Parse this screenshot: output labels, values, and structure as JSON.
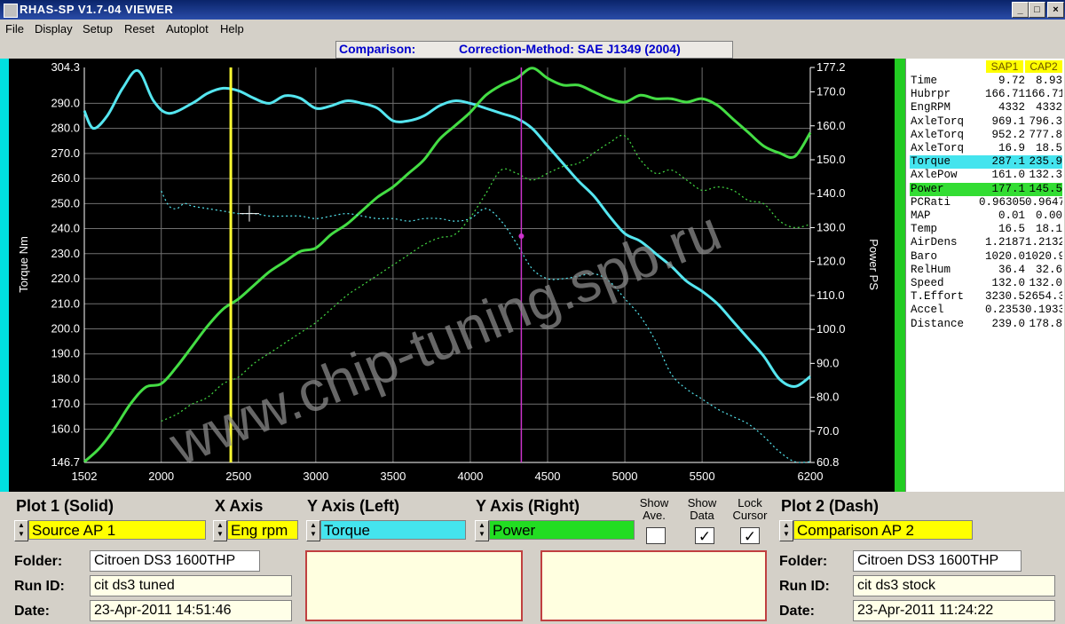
{
  "window": {
    "title": "RHAS-SP V1.7-04  VIEWER",
    "controls": [
      "_",
      "□",
      "×"
    ]
  },
  "menu": [
    "File",
    "Display",
    "Setup",
    "Reset",
    "Autoplot",
    "Help"
  ],
  "header": {
    "comparison": "Comparison:",
    "method": "Correction-Method: SAE J1349 (2004)"
  },
  "watermark": "www.chip-tuning.spb.ru",
  "chart_data": {
    "type": "line",
    "x_ticks": [
      "1502",
      "2000",
      "2500",
      "3000",
      "3500",
      "4000",
      "4500",
      "5000",
      "5500",
      "6200"
    ],
    "xlim": [
      1502,
      6200
    ],
    "ylabel_left": "Torque Nm",
    "ylabel_right": "Power PS",
    "ylim_left": [
      146.7,
      304.3
    ],
    "ylim_right": [
      60.8,
      177.2
    ],
    "y_ticks_left": [
      "304.3",
      "290.0",
      "280.0",
      "270.0",
      "260.0",
      "250.0",
      "240.0",
      "230.0",
      "220.0",
      "210.0",
      "200.0",
      "190.0",
      "180.0",
      "170.0",
      "160.0",
      "146.7"
    ],
    "y_ticks_right": [
      "177.2",
      "170.0",
      "160.0",
      "150.0",
      "140.0",
      "130.0",
      "120.0",
      "110.0",
      "100.0",
      "90.0",
      "80.0",
      "70.0",
      "60.8"
    ],
    "grid": true,
    "cursor_rpm": 2450,
    "cursor2_rpm": 4330,
    "colors": {
      "torque": "#55e6f0",
      "power": "#44dd44",
      "cursor1": "#ffff33",
      "cursor2": "#cc33cc",
      "grid": "#707070"
    },
    "series": [
      {
        "name": "Torque",
        "axis": "left",
        "style": "solid",
        "x": [
          1502,
          1560,
          1650,
          1750,
          1850,
          1950,
          2050,
          2200,
          2300,
          2400,
          2500,
          2600,
          2700,
          2800,
          2900,
          3000,
          3100,
          3200,
          3300,
          3400,
          3500,
          3600,
          3700,
          3800,
          3900,
          4000,
          4100,
          4200,
          4300,
          4400,
          4500,
          4600,
          4700,
          4800,
          4900,
          5000,
          5100,
          5200,
          5300,
          5400,
          5500,
          5600,
          5700,
          5800,
          5900,
          6000,
          6100,
          6200
        ],
        "values": [
          287,
          280,
          285,
          296,
          303,
          291,
          286,
          290,
          294,
          296,
          295,
          292,
          290,
          293,
          292,
          288,
          289,
          291,
          290,
          288,
          283,
          283,
          285,
          289,
          291,
          290,
          288,
          286,
          284,
          280,
          273,
          266,
          259,
          253,
          245,
          238,
          235,
          230,
          225,
          219,
          215,
          210,
          203,
          196,
          189,
          180,
          177,
          181
        ]
      },
      {
        "name": "Power",
        "axis": "right",
        "style": "solid",
        "x": [
          1502,
          1600,
          1700,
          1800,
          1900,
          2000,
          2100,
          2200,
          2300,
          2400,
          2500,
          2600,
          2700,
          2800,
          2900,
          3000,
          3100,
          3200,
          3300,
          3400,
          3500,
          3600,
          3700,
          3800,
          3900,
          4000,
          4100,
          4200,
          4300,
          4400,
          4500,
          4600,
          4700,
          4800,
          4900,
          5000,
          5100,
          5200,
          5300,
          5400,
          5500,
          5600,
          5700,
          5800,
          5900,
          6000,
          6100,
          6200
        ],
        "values": [
          61,
          65,
          71,
          78,
          83,
          84,
          89,
          95,
          101,
          106,
          109,
          113,
          117,
          120,
          123,
          124,
          128,
          131,
          135,
          139,
          142,
          146,
          150,
          156,
          160,
          164,
          169,
          172,
          174,
          177,
          174,
          172,
          172,
          170,
          168,
          167,
          169,
          168,
          168,
          167,
          168,
          166,
          162,
          158,
          154,
          152,
          151,
          158
        ]
      },
      {
        "name": "Torque",
        "axis": "left",
        "style": "dashed",
        "x": [
          2000,
          2050,
          2100,
          2150,
          2200,
          2300,
          2400,
          2500,
          2600,
          2700,
          2800,
          2900,
          3000,
          3100,
          3200,
          3300,
          3400,
          3500,
          3600,
          3700,
          3800,
          3900,
          4000,
          4100,
          4200,
          4300,
          4400,
          4500,
          4600,
          4700,
          4800,
          4900,
          5000,
          5100,
          5200,
          5300,
          5400,
          5500,
          5600,
          5700,
          5800,
          5900,
          6000,
          6100,
          6200
        ],
        "values": [
          255,
          249,
          248,
          250,
          249,
          248,
          247,
          246,
          246,
          245,
          245,
          245,
          244,
          245,
          246,
          245,
          244,
          244,
          243,
          244,
          244,
          243,
          244,
          248,
          243,
          234,
          224,
          220,
          220,
          221,
          222,
          219,
          212,
          205,
          195,
          182,
          176,
          172,
          168,
          165,
          162,
          157,
          151,
          147,
          147
        ]
      },
      {
        "name": "Power",
        "axis": "right",
        "style": "dashed",
        "x": [
          2000,
          2100,
          2200,
          2300,
          2400,
          2500,
          2600,
          2700,
          2800,
          2900,
          3000,
          3100,
          3200,
          3300,
          3400,
          3500,
          3600,
          3700,
          3800,
          3900,
          4000,
          4100,
          4200,
          4300,
          4400,
          4500,
          4600,
          4700,
          4800,
          4900,
          5000,
          5100,
          5200,
          5300,
          5400,
          5500,
          5600,
          5700,
          5800,
          5900,
          6000,
          6100,
          6200
        ],
        "values": [
          73,
          75,
          78,
          80,
          84,
          86,
          90,
          93,
          96,
          99,
          102,
          106,
          110,
          113,
          116,
          119,
          122,
          125,
          127,
          128,
          133,
          140,
          147,
          146,
          144,
          146,
          148,
          149,
          152,
          155,
          157,
          150,
          146,
          147,
          144,
          141,
          142,
          141,
          138,
          137,
          132,
          130,
          131
        ]
      }
    ]
  },
  "datapanel": {
    "headers": [
      "SAP1",
      "CAP2"
    ],
    "rows": [
      {
        "label": "Time",
        "v1": "9.72",
        "v2": "8.93"
      },
      {
        "label": "Hubrpr",
        "v1": "166.71",
        "v2": "166.71"
      },
      {
        "label": "EngRPM",
        "v1": "4332",
        "v2": "4332"
      },
      {
        "label": "AxleTorq",
        "v1": "969.1",
        "v2": "796.3"
      },
      {
        "label": "AxleTorq",
        "v1": "952.2",
        "v2": "777.8"
      },
      {
        "label": "AxleTorq",
        "v1": "16.9",
        "v2": "18.5"
      },
      {
        "label": "Torque",
        "v1": "287.1",
        "v2": "235.9",
        "highlight": "#44e4ee"
      },
      {
        "label": "AxlePow",
        "v1": "161.0",
        "v2": "132.3"
      },
      {
        "label": "Power",
        "v1": "177.1",
        "v2": "145.5",
        "highlight": "#33dd33"
      },
      {
        "label": "PCRati",
        "v1": "0.96305",
        "v2": "0.96474"
      },
      {
        "label": "MAP",
        "v1": "0.01",
        "v2": "0.00"
      },
      {
        "label": "Temp",
        "v1": "16.5",
        "v2": "18.1"
      },
      {
        "label": "AirDens",
        "v1": "1.2187",
        "v2": "1.2132"
      },
      {
        "label": "Baro",
        "v1": "1020.0",
        "v2": "1020.9"
      },
      {
        "label": "RelHum",
        "v1": "36.4",
        "v2": "32.6"
      },
      {
        "label": "Speed",
        "v1": "132.0",
        "v2": "132.0"
      },
      {
        "label": "T.Effort",
        "v1": "3230.5",
        "v2": "2654.3"
      },
      {
        "label": "Accel",
        "v1": "0.2353",
        "v2": "0.1933"
      },
      {
        "label": "Distance",
        "v1": "239.0",
        "v2": "178.8"
      }
    ]
  },
  "controls": {
    "plot1_label": "Plot 1 (Solid)",
    "xaxis_label": "X Axis",
    "yleft_label": "Y Axis (Left)",
    "yright_label": "Y Axis (Right)",
    "show_ave_label": "Show Ave.",
    "show_data_label": "Show Data",
    "lock_cursor_label": "Lock Cursor",
    "plot2_label": "Plot 2 (Dash)",
    "plot1_value": "Source AP 1",
    "xaxis_value": "Eng rpm",
    "yleft_value": "Torque",
    "yright_value": "Power",
    "plot2_value": "Comparison AP 2",
    "show_ave_checked": false,
    "show_data_checked": true,
    "lock_cursor_checked": true,
    "check_mark": "✓"
  },
  "run1": {
    "folder_label": "Folder:",
    "folder": "Citroen DS3 1600THP",
    "runid_label": "Run ID:",
    "runid": "cit ds3 tuned",
    "date_label": "Date:",
    "date": "23-Apr-2011  14:51:46"
  },
  "run2": {
    "folder_label": "Folder:",
    "folder": "Citroen DS3 1600THP",
    "runid_label": "Run ID:",
    "runid": "cit ds3 stock",
    "date_label": "Date:",
    "date": "23-Apr-2011  11:24:22"
  }
}
